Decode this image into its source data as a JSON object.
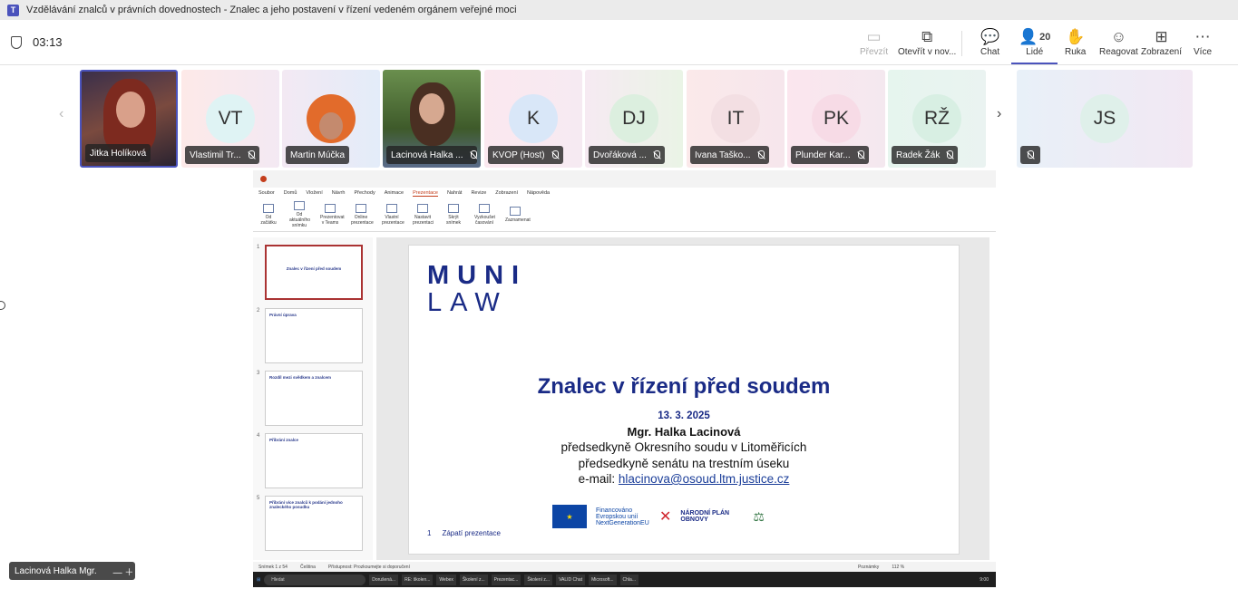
{
  "window": {
    "title": "Vzdělávání znalců v právních dovednostech - Znalec a jeho postavení v řízení vedeném orgánem veřejné moci"
  },
  "meeting": {
    "timer": "03:13",
    "people_count": "20"
  },
  "toolbar": [
    {
      "label": "Převzít",
      "icon": "share-take-icon",
      "dim": true
    },
    {
      "label": "Otevřít v nov...",
      "icon": "open-window-icon"
    },
    {
      "label": "Chat",
      "icon": "chat-icon"
    },
    {
      "label": "Lidé",
      "icon": "people-icon",
      "active": true
    },
    {
      "label": "Ruka",
      "icon": "hand-icon"
    },
    {
      "label": "Reagovat",
      "icon": "smile-icon"
    },
    {
      "label": "Zobrazení",
      "icon": "grid-icon"
    },
    {
      "label": "Více",
      "icon": "more-icon"
    }
  ],
  "participants": [
    {
      "name": "Jitka Holíková",
      "initials": "",
      "video": true,
      "muted": false
    },
    {
      "name": "Vlastimil Tr...",
      "initials": "VT",
      "muted": true
    },
    {
      "name": "Martin Múčka",
      "initials": "",
      "photo": true,
      "muted": false
    },
    {
      "name": "Lacinová Halka ...",
      "initials": "",
      "video": true,
      "muted": true
    },
    {
      "name": "KVOP (Host)",
      "initials": "K",
      "muted": true
    },
    {
      "name": "Dvořáková ...",
      "initials": "DJ",
      "muted": true
    },
    {
      "name": "Ivana Taško...",
      "initials": "IT",
      "muted": true
    },
    {
      "name": "Plunder Kar...",
      "initials": "PK",
      "muted": true
    },
    {
      "name": "Radek Žák",
      "initials": "RŽ",
      "muted": true
    }
  ],
  "extra_participant": {
    "initials": "JS"
  },
  "ppt": {
    "menu": [
      "Soubor",
      "Domů",
      "Vložení",
      "Návrh",
      "Přechody",
      "Animace",
      "Prezentace",
      "Nahrát",
      "Revize",
      "Zobrazení",
      "Nápověda"
    ],
    "active_menu": "Prezentace",
    "ribbon": [
      "Od začátku",
      "Od aktuálního snímku",
      "Prezentovat v Teams",
      "Online prezentace",
      "Vlastní prezentace",
      "Nastavit prezentaci",
      "Skrýt snímek",
      "Vyzkoušet časování",
      "Zaznamenat"
    ],
    "thumbnails": [
      {
        "num": "1",
        "title": "Znalec v řízení před soudem"
      },
      {
        "num": "2",
        "title": "Právní úprava"
      },
      {
        "num": "3",
        "title": "Rozdíl mezi svědkem a znalcem"
      },
      {
        "num": "4",
        "title": "Přibrání znalce"
      },
      {
        "num": "5",
        "title": "Přibrání více znalců k podání jednoho znaleckého posudku"
      }
    ],
    "slide": {
      "logo_top": "MUNI",
      "logo_bottom": "LAW",
      "title": "Znalec v řízení před soudem",
      "date": "13. 3. 2025",
      "name": "Mgr. Halka Lacinová",
      "line1": "předsedkyně Okresního soudu v Litoměřicích",
      "line2": "předsedkyně senátu na trestním úseku",
      "email_label": "e-mail: ",
      "email": "hlacinova@osoud.ltm.justice.cz",
      "eu_text": "Financováno Evropskou unií NextGenerationEU",
      "npo_text": "NÁRODNÍ PLÁN OBNOVY",
      "footer_num": "1",
      "footer_text": "Zápatí prezentace"
    },
    "status": [
      "Snímek 1 z 54",
      "Čeština",
      "Přístupnost: Prozkoumejte si doporučení",
      "Poznámky",
      "112 %"
    ],
    "taskbar": [
      "Hledat",
      "Dorušená...",
      "RE: školen...",
      "Webex",
      "Školení z...",
      "Prezentac...",
      "Školení z...",
      "VALID Chat",
      "Microsoft...",
      "Chla..."
    ],
    "clock": "9:00"
  },
  "selfview": {
    "name": "Lacinová Halka Mgr."
  }
}
